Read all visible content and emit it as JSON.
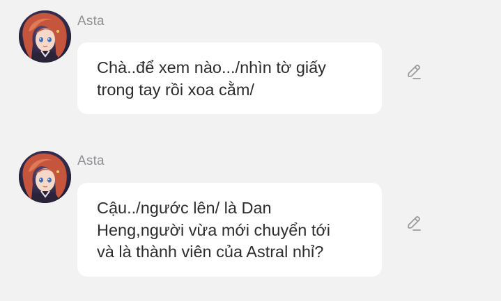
{
  "theme": {
    "background": "#f2f2f3",
    "bubble": "#ffffff",
    "text": "#2c2c2e",
    "sender": "#8f8f94",
    "icon": "#9a9a9e"
  },
  "messages": [
    {
      "sender": "Asta",
      "avatar_icon": "asta-avatar",
      "lines": [
        "Chà..để xem nào.../nhìn tờ giấy",
        "trong tay rồi xoa cằm/"
      ],
      "action_icon": "edit-pencil-icon"
    },
    {
      "sender": "Asta",
      "avatar_icon": "asta-avatar",
      "lines": [
        "Cậu../ngước lên/ là Dan",
        "Heng,người vừa mới chuyển tới",
        "và là thành viên của Astral nhỉ?"
      ],
      "action_icon": "edit-pencil-icon"
    }
  ]
}
